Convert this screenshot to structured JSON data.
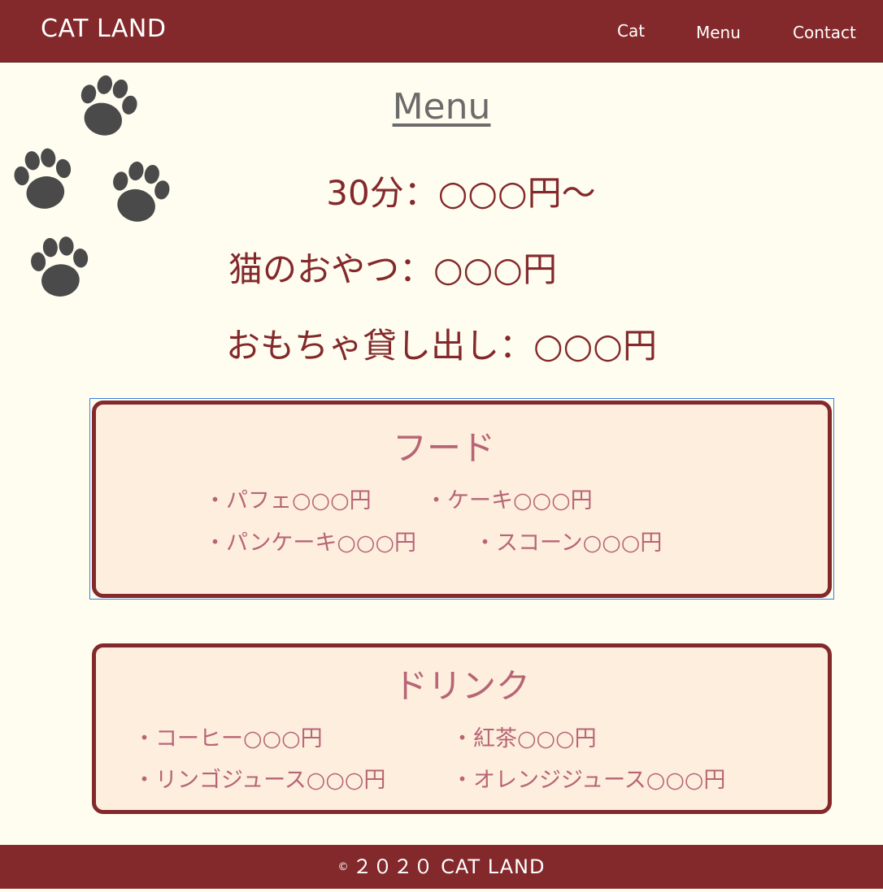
{
  "header": {
    "brand": "CAT LAND",
    "nav": [
      {
        "label": "Cat"
      },
      {
        "label": "Menu"
      },
      {
        "label": "Contact"
      }
    ]
  },
  "decor": {
    "paw_color": "#4a4a4a",
    "icon": "paw-icon"
  },
  "menu": {
    "title": "Menu",
    "prices": [
      "30分：○○○円〜",
      "猫のおやつ：○○○円",
      "おもちゃ貸し出し：○○○円"
    ]
  },
  "food": {
    "heading": "フード",
    "items": [
      "・パフェ○○○円",
      "・ケーキ○○○円",
      "・パンケーキ○○○円",
      "・スコーン○○○円"
    ]
  },
  "drink": {
    "heading": "ドリンク",
    "items": [
      "・コーヒー○○○円",
      "・紅茶○○○円",
      "・リンゴジュース○○○円",
      "・オレンジジュース○○○円"
    ]
  },
  "footer": {
    "copyright_symbol": "©",
    "text": "２０２０ CAT LAND"
  },
  "colors": {
    "primary": "#83292b",
    "background": "#fffdf0",
    "box_bg": "#fdeede",
    "accent_text": "#b76575"
  }
}
